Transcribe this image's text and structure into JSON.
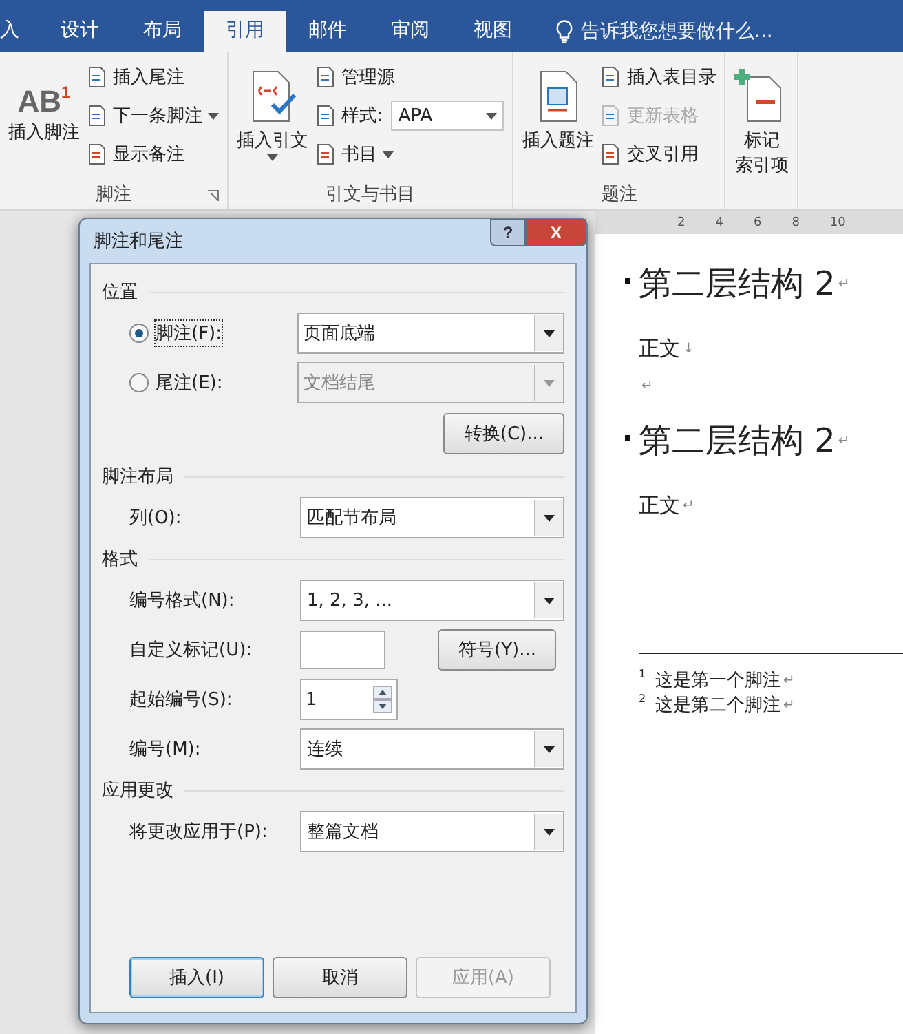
{
  "tabs": [
    {
      "label": "入",
      "selected": false
    },
    {
      "label": "设计",
      "selected": false
    },
    {
      "label": "布局",
      "selected": false
    },
    {
      "label": "引用",
      "selected": true
    },
    {
      "label": "邮件",
      "selected": false
    },
    {
      "label": "审阅",
      "selected": false
    },
    {
      "label": "视图",
      "selected": false
    }
  ],
  "tell_me": "告诉我您想要做什么...",
  "ribbon_groups": [
    {
      "label": "脚注",
      "launcher": true,
      "big": {
        "lines": [
          "插入脚注"
        ],
        "icon_text": "AB",
        "icon_sup": "1"
      },
      "small": [
        {
          "label": "插入尾注",
          "dropdown": false,
          "disabled": false
        },
        {
          "label": "下一条脚注",
          "dropdown": true,
          "disabled": false
        },
        {
          "label": "显示备注",
          "dropdown": false,
          "disabled": false
        }
      ]
    },
    {
      "label": "引文与书目",
      "big": {
        "lines": [
          "插入引文"
        ],
        "dropdown": true
      },
      "small": [
        {
          "label": "管理源",
          "dropdown": false,
          "disabled": false
        },
        {
          "label": "样式:",
          "dropdown": false,
          "disabled": false,
          "select": "APA"
        },
        {
          "label": "书目",
          "dropdown": true,
          "disabled": false
        }
      ]
    },
    {
      "label": "题注",
      "big": {
        "lines": [
          "插入题注"
        ]
      },
      "small": [
        {
          "label": "插入表目录",
          "dropdown": false,
          "disabled": false
        },
        {
          "label": "更新表格",
          "dropdown": false,
          "disabled": true
        },
        {
          "label": "交叉引用",
          "dropdown": false,
          "disabled": false
        }
      ]
    },
    {
      "big": {
        "lines": [
          "标记",
          "索引项"
        ]
      }
    }
  ],
  "document": {
    "ruler": [
      "2",
      "4",
      "6",
      "8",
      "10"
    ],
    "paragraphs": [
      {
        "kind": "heading",
        "text": "第二层结构 2",
        "mark": "↵"
      },
      {
        "kind": "body",
        "text": "正文",
        "mark": "↓"
      },
      {
        "kind": "empty",
        "mark": "↵"
      },
      {
        "kind": "heading",
        "text": "第二层结构 2",
        "mark": "↵"
      },
      {
        "kind": "body",
        "text": "正文",
        "mark": "↵"
      }
    ],
    "footnotes": [
      {
        "number": "1",
        "text": "这是第一个脚注",
        "mark": "↵"
      },
      {
        "number": "2",
        "text": "这是第二个脚注",
        "mark": "↵"
      }
    ]
  },
  "dialog": {
    "title": "脚注和尾注",
    "help": "?",
    "close": "X",
    "sections": [
      {
        "title": "位置",
        "rows": [
          {
            "kind": "radio-select",
            "label": "脚注(F):",
            "selected": true,
            "value": "页面底端",
            "disabled": false
          },
          {
            "kind": "radio-select",
            "label": "尾注(E):",
            "selected": false,
            "value": "文档结尾",
            "disabled": true
          },
          {
            "kind": "button",
            "label": "转换(C)..."
          }
        ]
      },
      {
        "title": "脚注布局",
        "rows": [
          {
            "kind": "select",
            "label": "列(O):",
            "value": "匹配节布局",
            "disabled": false
          }
        ]
      },
      {
        "title": "格式",
        "rows": [
          {
            "kind": "select",
            "label": "编号格式(N):",
            "value": "1, 2, 3, ...",
            "disabled": false
          },
          {
            "kind": "input-button",
            "label": "自定义标记(U):",
            "button": "符号(Y)..."
          },
          {
            "kind": "spinner",
            "label": "起始编号(S):",
            "value": "1"
          },
          {
            "kind": "select",
            "label": "编号(M):",
            "value": "连续",
            "disabled": false
          }
        ]
      },
      {
        "title": "应用更改",
        "rows": [
          {
            "kind": "select",
            "label": "将更改应用于(P):",
            "value": "整篇文档",
            "disabled": false
          }
        ]
      }
    ],
    "buttons": [
      {
        "label": "插入(I)",
        "default": true,
        "disabled": false
      },
      {
        "label": "取消",
        "default": false,
        "disabled": false
      },
      {
        "label": "应用(A)",
        "default": false,
        "disabled": true
      }
    ]
  }
}
